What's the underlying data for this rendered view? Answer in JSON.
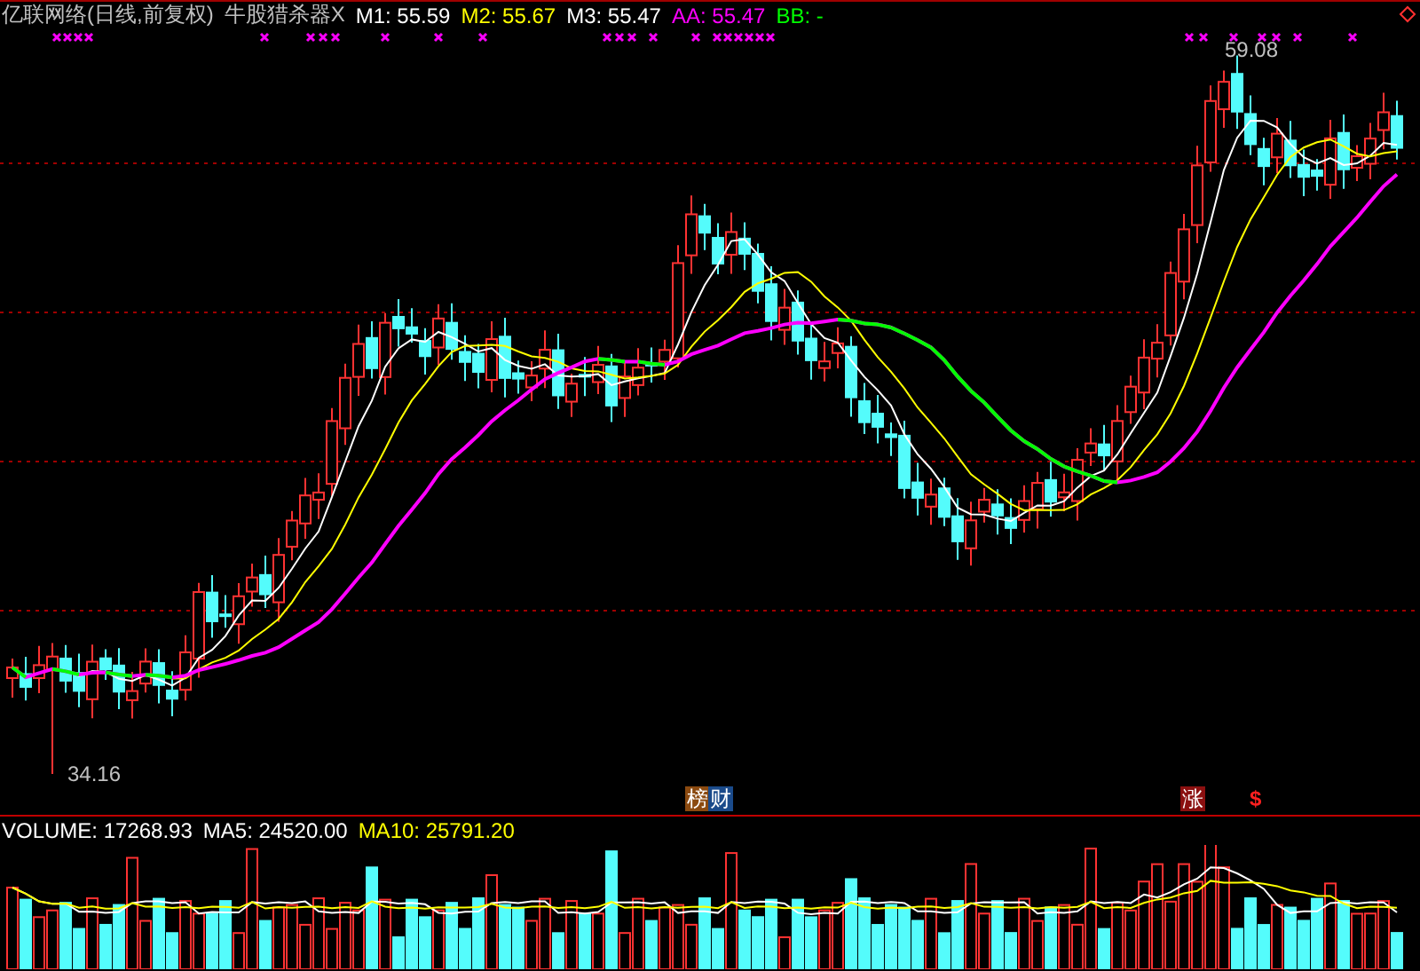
{
  "title": "亿联网络(日线,前复权)",
  "indicator": {
    "name": "牛股猎杀器X",
    "values": [
      {
        "text": "M1: 55.59",
        "color": "#ffffff"
      },
      {
        "text": "M2: 55.67",
        "color": "#ffff00"
      },
      {
        "text": "M3: 55.47",
        "color": "#ffffff"
      },
      {
        "text": "AA: 55.47",
        "color": "#ff00ff"
      },
      {
        "text": "BB: -",
        "color": "#00ff00"
      }
    ]
  },
  "chart": {
    "high_label": "59.08",
    "low_label": "34.16"
  },
  "signals": [
    {
      "text": "榜",
      "kind": "badge",
      "color": "#8b4a10"
    },
    {
      "text": "财",
      "kind": "badge",
      "color": "#1a4a8a"
    },
    {
      "text": "涨",
      "kind": "badge",
      "color": "#8b1010"
    },
    {
      "text": "$",
      "kind": "symbol",
      "color": "#ff2020"
    }
  ],
  "volume": {
    "values": [
      {
        "text": "VOLUME: 17268.93",
        "color": "#ffffff"
      },
      {
        "text": "MA5: 24520.00",
        "color": "#ffffff"
      },
      {
        "text": "MA10: 25791.20",
        "color": "#ffff00"
      }
    ]
  }
}
